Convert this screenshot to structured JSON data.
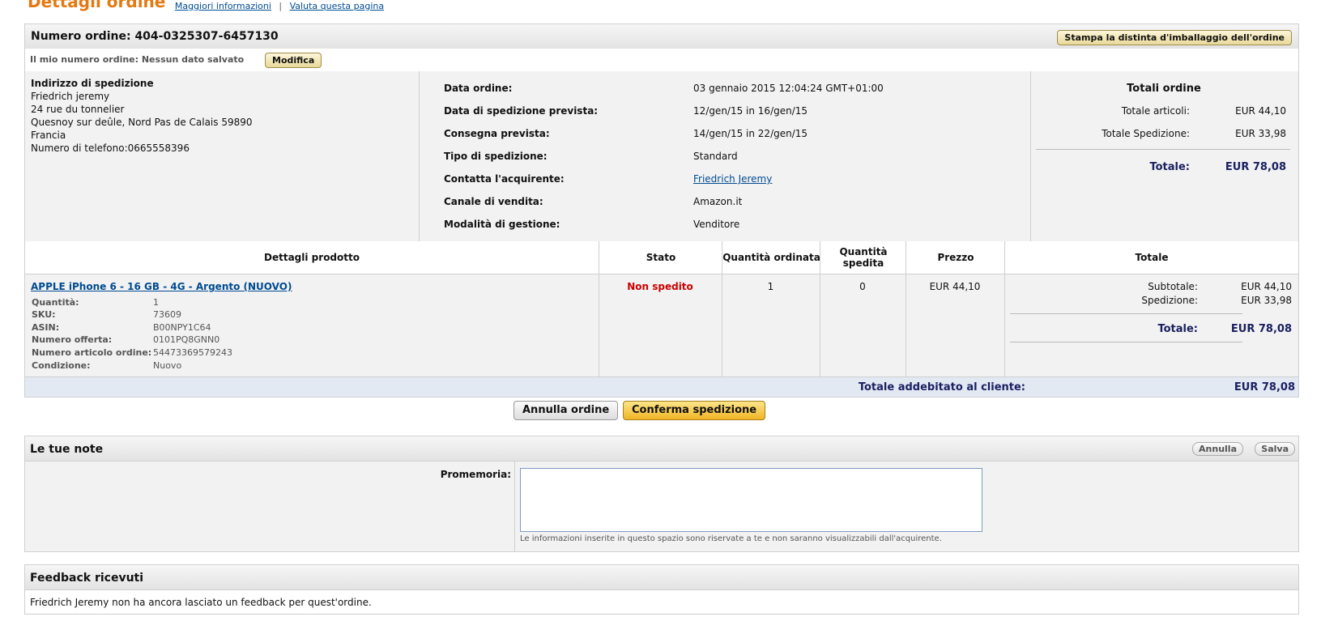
{
  "page": {
    "title": "Dettagli ordine",
    "link_more_info": "Maggiori informazioni",
    "link_rate": "Valuta questa pagina",
    "separator": "|"
  },
  "order": {
    "number_label": "Numero ordine: 404-0325307-6457130",
    "print_button": "Stampa la distinta d'imballaggio dell'ordine",
    "my_number_label": "Il mio numero ordine: Nessun dato salvato",
    "modify_button": "Modifica"
  },
  "shipping_address": {
    "heading": "Indirizzo di spedizione",
    "lines": [
      "Friedrich jeremy",
      "24 rue du tonnelier",
      "Quesnoy sur deûle, Nord Pas de Calais 59890",
      "Francia",
      "Numero di telefono:0665558396"
    ]
  },
  "meta": [
    {
      "label": "Data ordine:",
      "value": "03 gennaio 2015 12:04:24 GMT+01:00"
    },
    {
      "label": "Data di spedizione prevista:",
      "value": "12/gen/15 in 16/gen/15"
    },
    {
      "label": "Consegna prevista:",
      "value": "14/gen/15 in 22/gen/15"
    },
    {
      "label": "Tipo di spedizione:",
      "value": "Standard"
    },
    {
      "label": "Contatta l'acquirente:",
      "value": "Friedrich Jeremy"
    },
    {
      "label": "Canale di vendita:",
      "value": "Amazon.it"
    },
    {
      "label": "Modalità di gestione:",
      "value": "Venditore"
    }
  ],
  "order_totals": {
    "heading": "Totali ordine",
    "items_label": "Totale articoli:",
    "items_value": "EUR 44,10",
    "shipping_label": "Totale Spedizione:",
    "shipping_value": "EUR 33,98",
    "total_label": "Totale:",
    "total_value": "EUR 78,08"
  },
  "product_table": {
    "headers": [
      "Dettagli prodotto",
      "Stato",
      "Quantità ordinata",
      "Quantità spedita",
      "Prezzo",
      "Totale"
    ],
    "product_name": "APPLE iPhone 6 - 16 GB - 4G - Argento (NUOVO)",
    "details": [
      {
        "label": "Quantità:",
        "value": "1"
      },
      {
        "label": "SKU:",
        "value": "73609"
      },
      {
        "label": "ASIN:",
        "value": "B00NPY1C64"
      },
      {
        "label": "Numero offerta:",
        "value": "0101PQ8GNN0"
      },
      {
        "label": "Numero articolo ordine:",
        "value": "54473369579243"
      },
      {
        "label": "Condizione:",
        "value": "Nuovo"
      }
    ],
    "status": "Non spedito",
    "qty_ordered": "1",
    "qty_shipped": "0",
    "price": "EUR 44,10",
    "subtotal_label": "Subtotale:",
    "subtotal_value": "EUR 44,10",
    "shipping_label": "Spedizione:",
    "shipping_value": "EUR 33,98",
    "total_label": "Totale:",
    "total_value": "EUR 78,08",
    "charged_label": "Totale addebitato al cliente:",
    "charged_value": "EUR 78,08"
  },
  "actions": {
    "cancel_order": "Annulla ordine",
    "confirm_shipment": "Conferma spedizione"
  },
  "notes": {
    "heading": "Le tue note",
    "cancel": "Annulla",
    "save": "Salva",
    "reminder_label": "Promemoria:",
    "hint": "Le informazioni inserite in questo spazio sono riservate a te e non saranno visualizzabili dall'acquirente."
  },
  "feedback": {
    "heading": "Feedback ricevuti",
    "message": "Friedrich Jeremy non ha ancora lasciato un feedback per quest'ordine."
  }
}
